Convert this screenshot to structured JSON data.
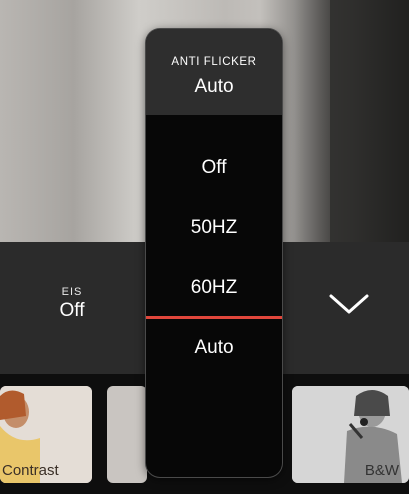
{
  "anti_flicker": {
    "title": "ANTI FLICKER",
    "current": "Auto",
    "options": [
      "Off",
      "50HZ",
      "60HZ",
      "Auto"
    ],
    "selected": "Auto"
  },
  "eis": {
    "label": "EIS",
    "value": "Off"
  },
  "filters": {
    "items": [
      {
        "label": "Contrast"
      },
      {
        "label": ""
      },
      {
        "label": "B&W"
      }
    ]
  },
  "colors": {
    "accent_line": "#e0463b"
  },
  "icons": {
    "collapse": "chevron-down-icon"
  }
}
